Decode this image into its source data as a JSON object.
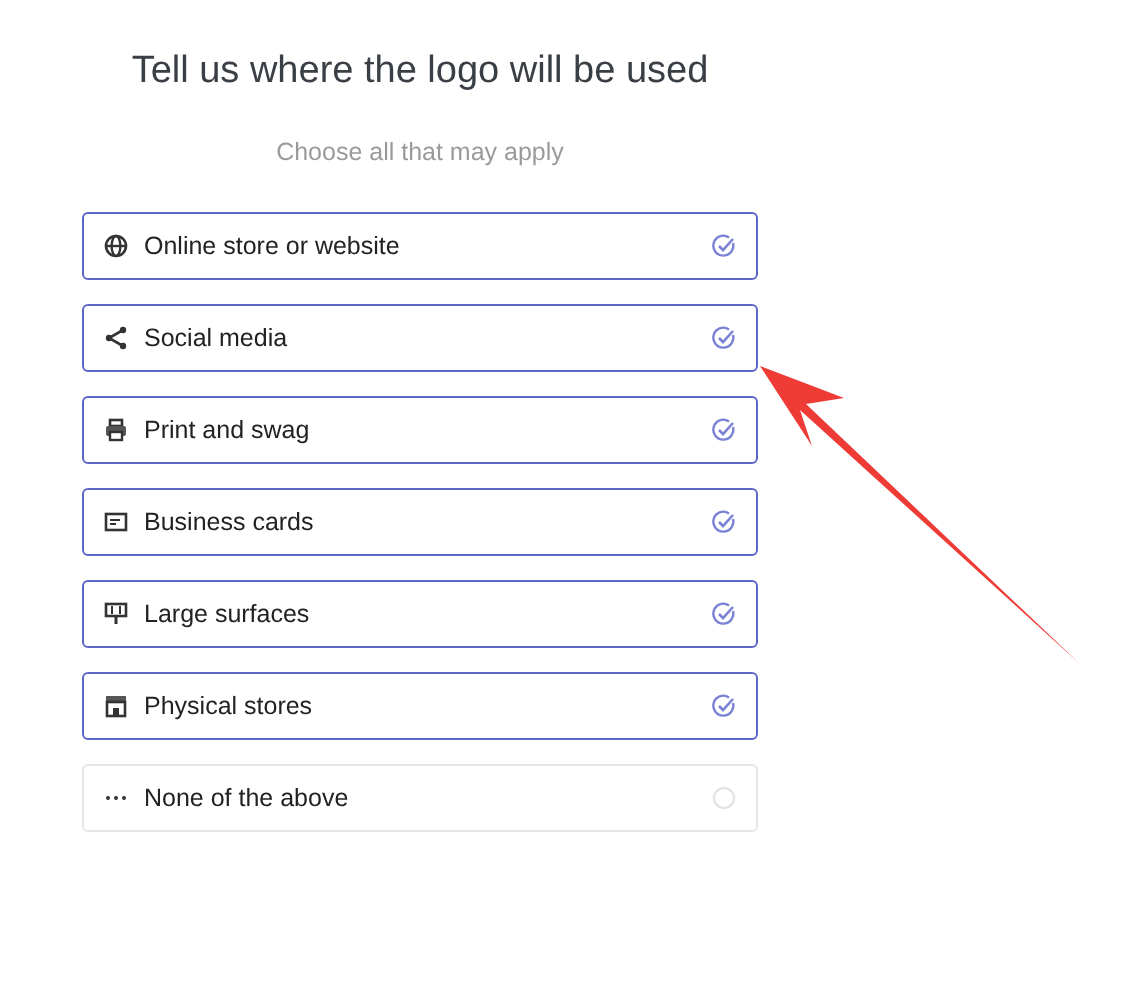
{
  "title": "Tell us where the logo will be used",
  "subtitle": "Choose all that may apply",
  "options": [
    {
      "label": "Online store or website",
      "checked": true
    },
    {
      "label": "Social media",
      "checked": true
    },
    {
      "label": "Print and swag",
      "checked": true
    },
    {
      "label": "Business cards",
      "checked": true
    },
    {
      "label": "Large surfaces",
      "checked": true
    },
    {
      "label": "Physical stores",
      "checked": true
    },
    {
      "label": "None of the above",
      "checked": false
    }
  ]
}
